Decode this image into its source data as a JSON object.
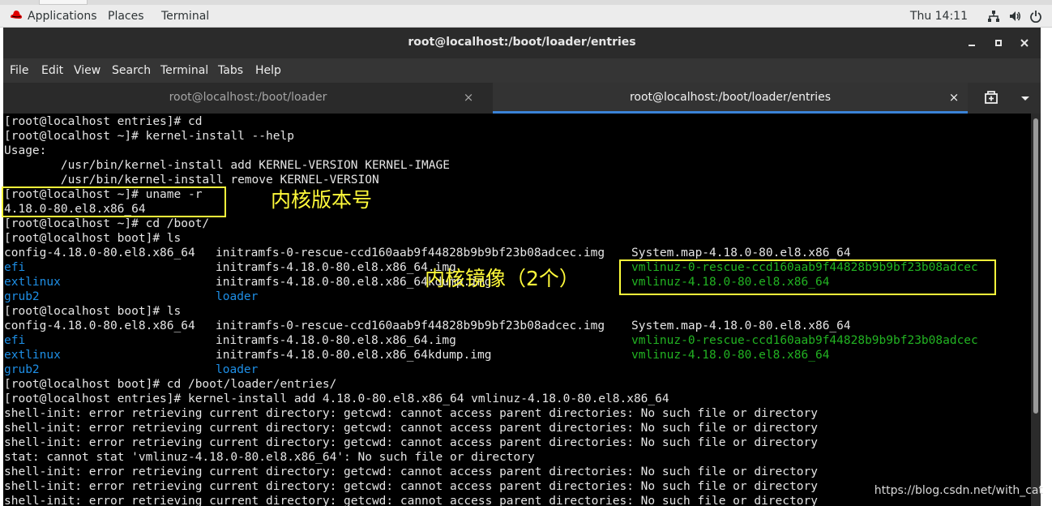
{
  "topbar": {
    "applications": "Applications",
    "places": "Places",
    "terminal": "Terminal",
    "clock": "Thu 14:11",
    "icons": [
      "network-icon",
      "volume-icon",
      "power-icon"
    ]
  },
  "window": {
    "title": "root@localhost:/boot/loader/entries"
  },
  "menubar": {
    "items": [
      "File",
      "Edit",
      "View",
      "Search",
      "Terminal",
      "Tabs",
      "Help"
    ]
  },
  "tabs": [
    {
      "label": "root@localhost:/boot/loader",
      "close": "×"
    },
    {
      "label": "root@localhost:/boot/loader/entries",
      "close": "×"
    }
  ],
  "terminal": {
    "lines": [
      "[root@localhost entries]# cd",
      "[root@localhost ~]# kernel-install --help",
      "Usage:",
      "        /usr/bin/kernel-install add KERNEL-VERSION KERNEL-IMAGE",
      "        /usr/bin/kernel-install remove KERNEL-VERSION",
      "[root@localhost ~]# uname -r",
      "4.18.0-80.el8.x86_64",
      "[root@localhost ~]# cd /boot/",
      "[root@localhost boot]# ls",
      null,
      null,
      null,
      null,
      "[root@localhost boot]# ls",
      null,
      null,
      null,
      null,
      "[root@localhost boot]# cd /boot/loader/entries/",
      "[root@localhost entries]# kernel-install add 4.18.0-80.el8.x86_64 vmlinuz-4.18.0-80.el8.x86_64",
      "shell-init: error retrieving current directory: getcwd: cannot access parent directories: No such file or directory",
      "shell-init: error retrieving current directory: getcwd: cannot access parent directories: No such file or directory",
      "shell-init: error retrieving current directory: getcwd: cannot access parent directories: No such file or directory",
      "stat: cannot stat 'vmlinuz-4.18.0-80.el8.x86_64': No such file or directory",
      "shell-init: error retrieving current directory: getcwd: cannot access parent directories: No such file or directory",
      "shell-init: error retrieving current directory: getcwd: cannot access parent directories: No such file or directory",
      "shell-init: error retrieving current directory: getcwd: cannot access parent directories: No such file or directory"
    ],
    "ls_output": [
      {
        "c1": "config-4.18.0-80.el8.x86_64",
        "c2": "initramfs-0-rescue-ccd160aab9f44828b9b9bf23b08adcec.img",
        "c3": "System.map-4.18.0-80.el8.x86_64"
      },
      {
        "c1": "efi",
        "c2": "initramfs-4.18.0-80.el8.x86_64.img",
        "c3": "vmlinuz-0-rescue-ccd160aab9f44828b9b9bf23b08adcec"
      },
      {
        "c1": "extlinux",
        "c2": "initramfs-4.18.0-80.el8.x86_64kdump.img",
        "c3": "vmlinuz-4.18.0-80.el8.x86_64"
      },
      {
        "c1": "grub2",
        "c2": "loader",
        "c3": ""
      }
    ],
    "colors": {
      "background": "#000000",
      "text": "#e5e5e5",
      "directory": "#1e8fe6",
      "executable": "#22b322"
    }
  },
  "annotations": {
    "kernel_version": "内核版本号",
    "kernel_images": "内核镜像（2个）",
    "color": "#ffff3b"
  },
  "watermark": "https://blog.csdn.net/with_cat"
}
